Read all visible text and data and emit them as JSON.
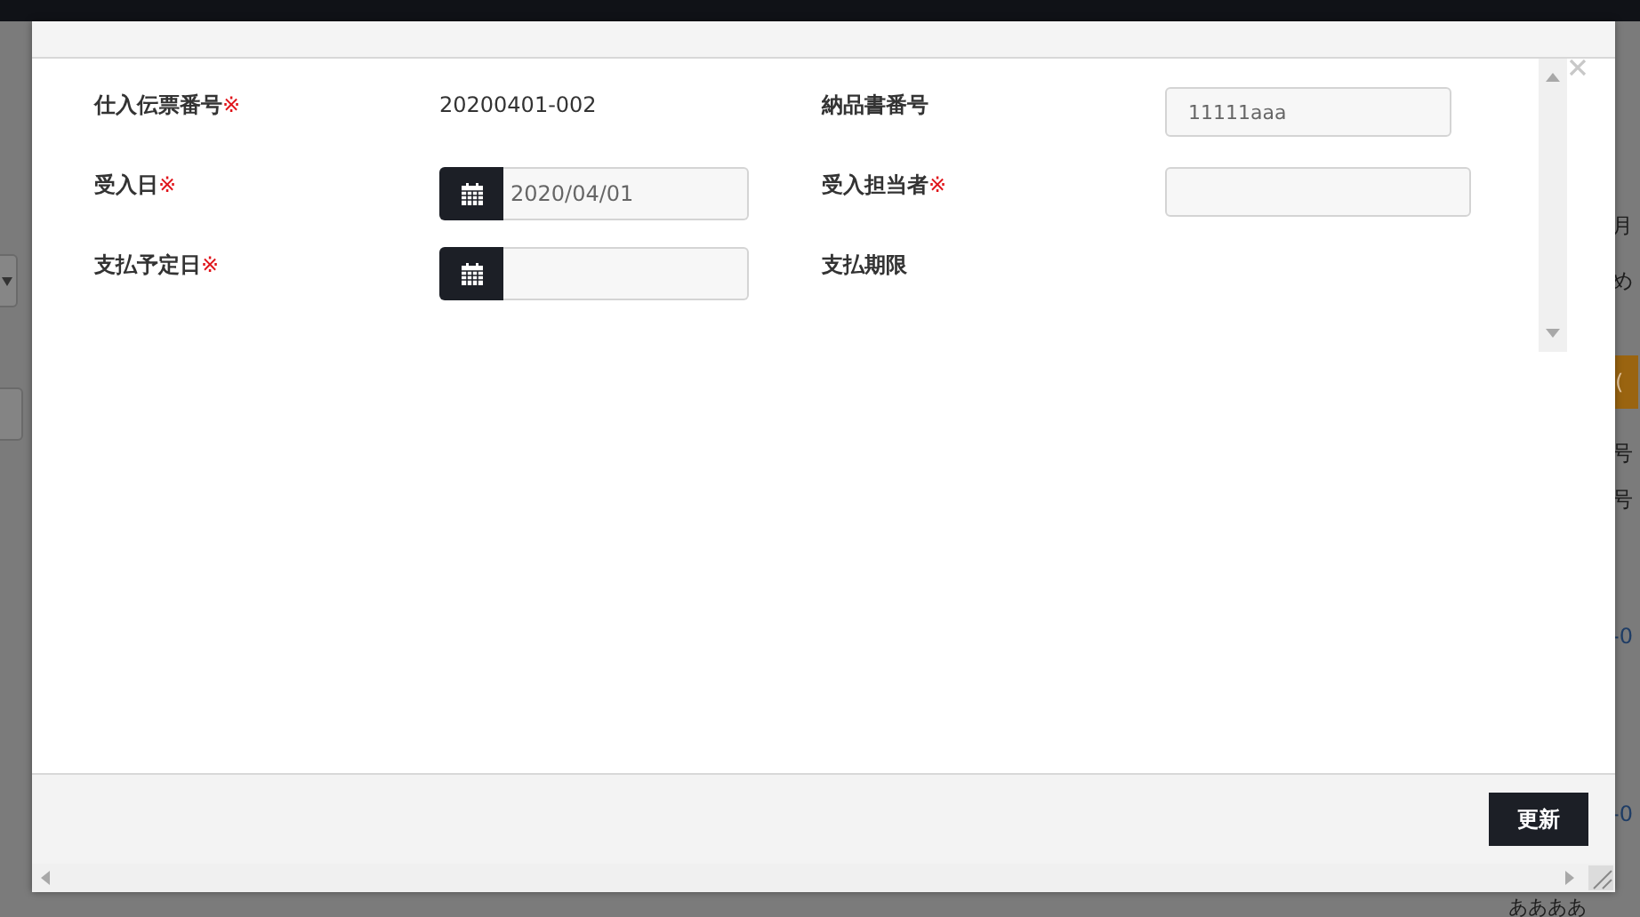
{
  "background": {
    "fragments": [
      {
        "text": "月",
        "kind": "text"
      },
      {
        "text": "め",
        "kind": "text"
      },
      {
        "text": "(",
        "kind": "badge"
      },
      {
        "text": "号",
        "kind": "text"
      },
      {
        "text": "号",
        "kind": "text"
      },
      {
        "text": "-0",
        "kind": "link"
      },
      {
        "text": "-0",
        "kind": "link"
      }
    ],
    "footer_text": "ああああ"
  },
  "dialog": {
    "required_mark": "※",
    "fields": [
      {
        "label": "仕入伝票番号",
        "required": true,
        "kind": "text",
        "value": "20200401-002"
      },
      {
        "label": "納品書番号",
        "required": false,
        "kind": "input",
        "value": "11111aaa"
      },
      {
        "label": "受入日",
        "required": true,
        "kind": "date",
        "value": "2020/04/01"
      },
      {
        "label": "受入担当者",
        "required": true,
        "kind": "input"
      },
      {
        "label": "支払予定日",
        "required": true,
        "kind": "date"
      },
      {
        "label": "支払期限",
        "required": false,
        "kind": "none"
      }
    ],
    "button": "更新"
  }
}
